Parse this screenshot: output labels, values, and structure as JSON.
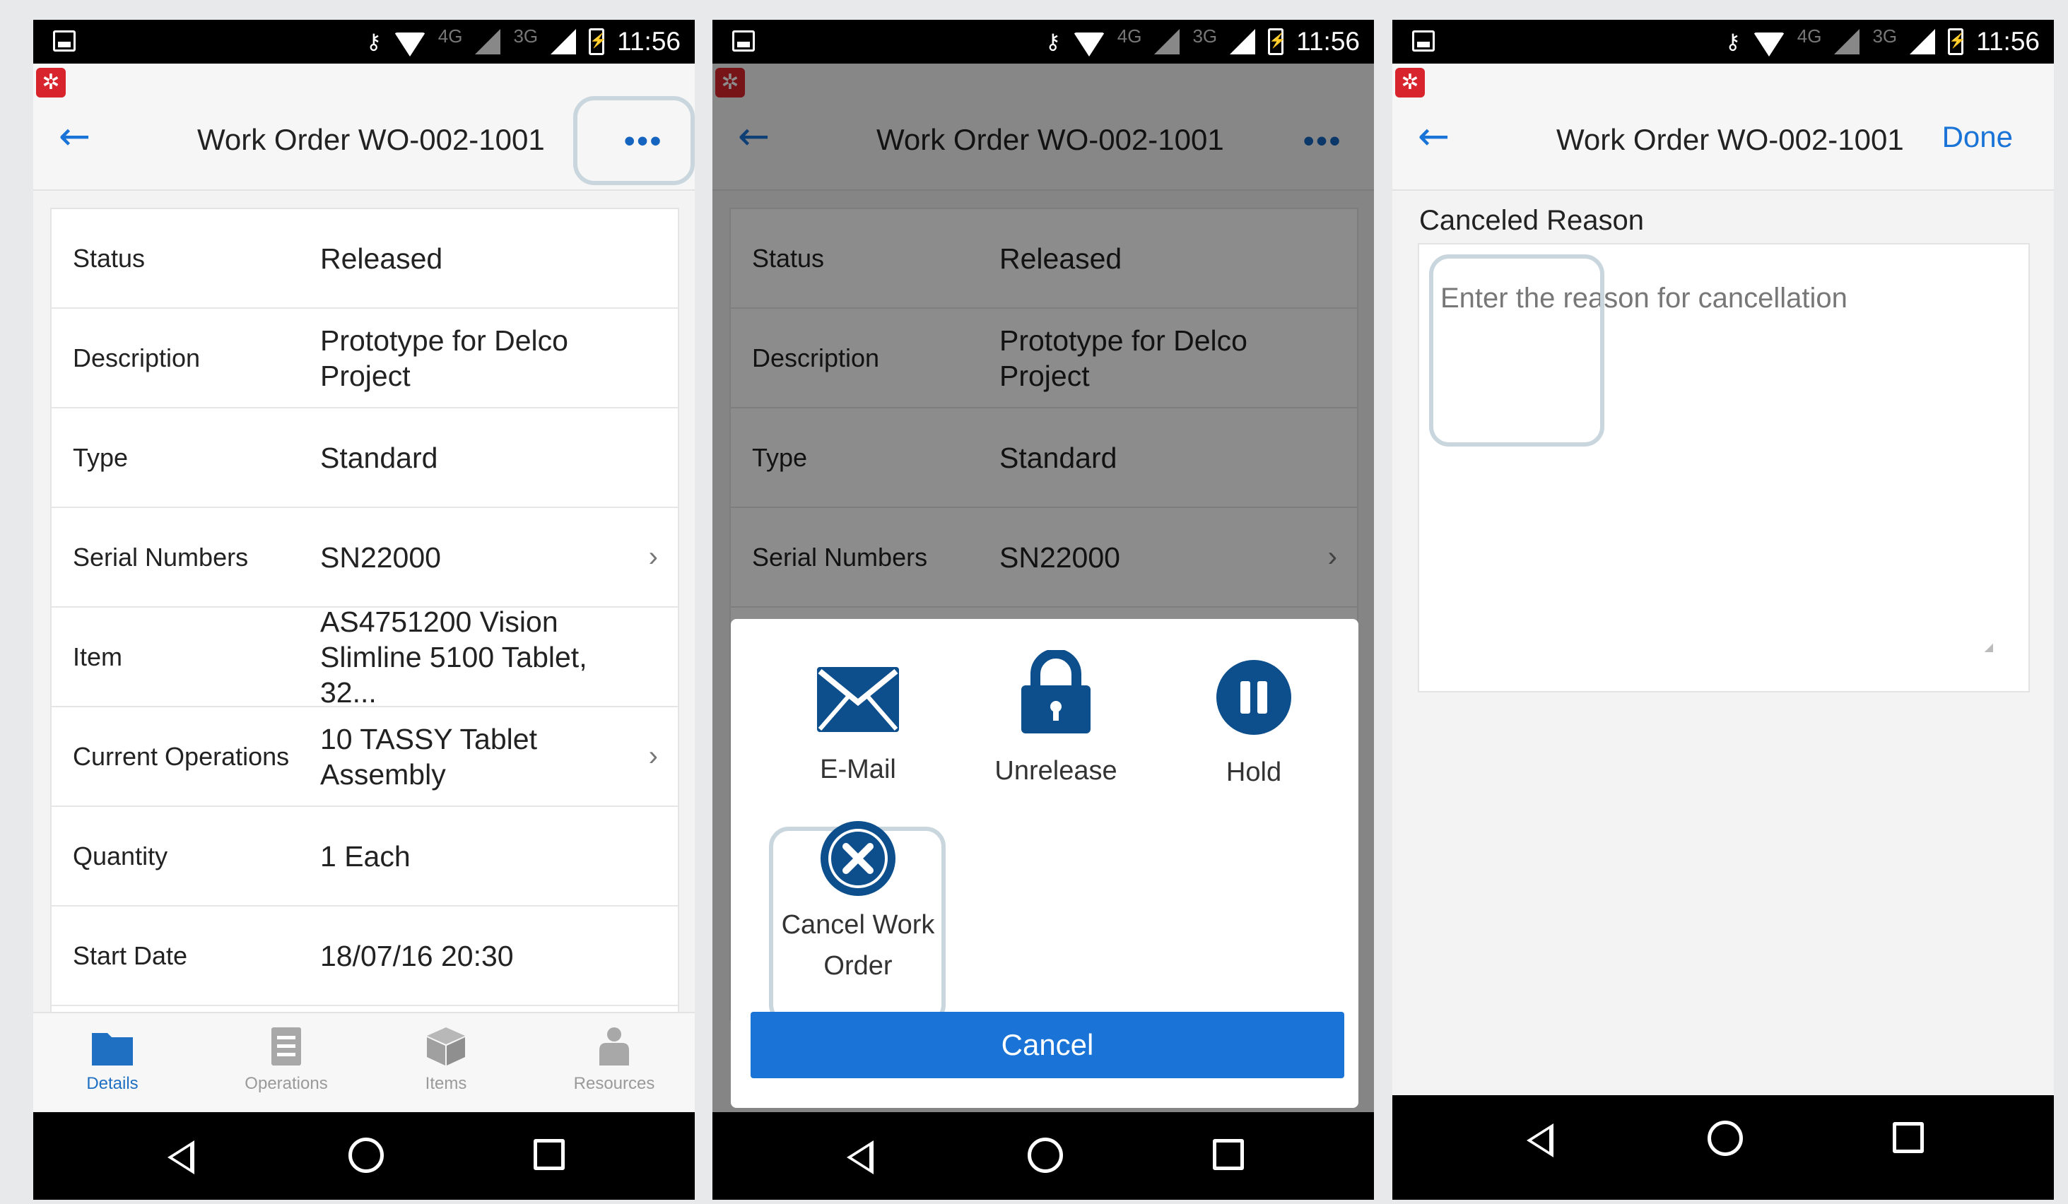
{
  "status_bar": {
    "time": "11:56",
    "key_icon": "key-icon",
    "net_4g": "4G",
    "net_3g": "3G"
  },
  "screen1": {
    "title": "Work Order WO-002-1001",
    "more_label": "•••",
    "rows": [
      {
        "label": "Status",
        "value": "Released",
        "chevron": false
      },
      {
        "label": "Description",
        "value": "Prototype for Delco Project",
        "chevron": false
      },
      {
        "label": "Type",
        "value": "Standard",
        "chevron": false
      },
      {
        "label": "Serial Numbers",
        "value": "SN22000",
        "chevron": true
      },
      {
        "label": "Item",
        "value": "AS4751200 Vision Slimline 5100 Tablet, 32...",
        "chevron": false
      },
      {
        "label": "Current Operations",
        "value": "10 TASSY Tablet Assembly",
        "chevron": true
      },
      {
        "label": "Quantity",
        "value": "1 Each",
        "chevron": false
      },
      {
        "label": "Start Date",
        "value": "18/07/16 20:30",
        "chevron": false
      }
    ],
    "tabs": [
      {
        "label": "Details",
        "icon": "folder-icon",
        "active": true
      },
      {
        "label": "Operations",
        "icon": "list-icon",
        "active": false
      },
      {
        "label": "Items",
        "icon": "box-icon",
        "active": false
      },
      {
        "label": "Resources",
        "icon": "person-icon",
        "active": false
      }
    ],
    "colors": {
      "accent": "#1a73d6",
      "tab_active": "#1f6fc2"
    }
  },
  "screen2": {
    "title": "Work Order WO-002-1001",
    "more_label": "•••",
    "rows": [
      {
        "label": "Status",
        "value": "Released",
        "chevron": false
      },
      {
        "label": "Description",
        "value": "Prototype for Delco Project",
        "chevron": false
      },
      {
        "label": "Type",
        "value": "Standard",
        "chevron": false
      },
      {
        "label": "Serial Numbers",
        "value": "SN22000",
        "chevron": true
      },
      {
        "label": "",
        "value": "AS4751200 Vision",
        "chevron": false
      }
    ],
    "actions": [
      {
        "label": "E-Mail",
        "icon": "envelope-icon"
      },
      {
        "label": "Unrelease",
        "icon": "padlock-icon"
      },
      {
        "label": "Hold",
        "icon": "pause-icon"
      },
      {
        "label": "Cancel Work Order",
        "icon": "cancel-x-icon"
      }
    ],
    "cancel_label": "Cancel",
    "colors": {
      "icon_blue": "#0d4f8c",
      "button_blue": "#1a73d6"
    }
  },
  "screen3": {
    "title": "Work Order WO-002-1001",
    "done_label": "Done",
    "field_label": "Canceled Reason",
    "placeholder": "Enter the reason for cancellation",
    "value": ""
  }
}
